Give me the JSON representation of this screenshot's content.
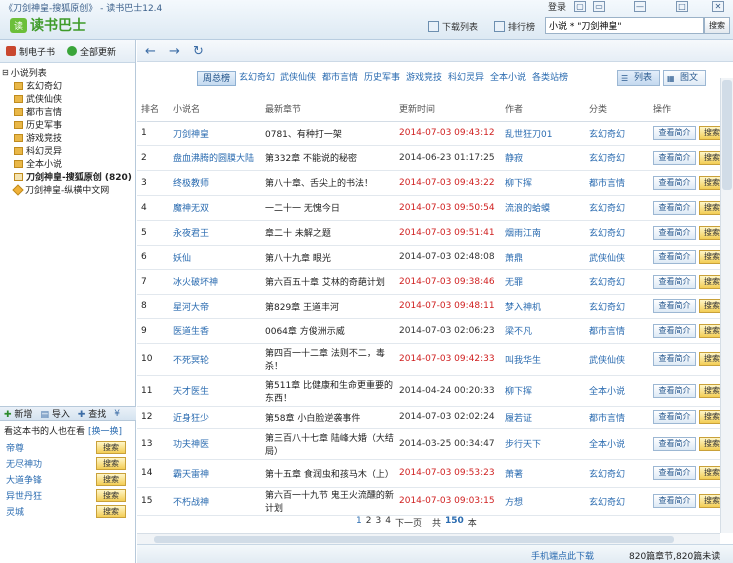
{
  "window": {
    "title": "《刀剑神皇-搜狐原创》 - 读书巴士12.4",
    "app_name": "读书巴士",
    "logo_glyph": "读",
    "login": "登录",
    "controls": [
      "▢",
      "▭",
      "—",
      "□",
      "✕"
    ]
  },
  "toolbar": {
    "downloads": "下载列表",
    "rankings": "排行榜",
    "search_value": "小说 * \"刀剑神皇\"",
    "search_button": "搜索"
  },
  "sidebar": {
    "make_ebook": "制电子书",
    "update_all": "全部更新",
    "tree_root": "小说列表",
    "tree_items": [
      "玄幻奇幻",
      "武侠仙侠",
      "都市言情",
      "历史军事",
      "游戏竞技",
      "科幻灵异",
      "全本小说"
    ],
    "tree_book": "刀剑神皇-搜狐原创 (820)",
    "tree_book2": "刀剑神皇-纵横中文网",
    "tools": {
      "add": "新增",
      "import": "导入",
      "find": "查找"
    },
    "also_reading": "看这本书的人也在看",
    "refresh": "[换一换]",
    "recommendations": [
      "帝尊",
      "无尽神功",
      "大道争锋",
      "异世丹狂",
      "灵城"
    ],
    "search_button": "搜索"
  },
  "navbar": {
    "back": "←",
    "forward": "→",
    "refresh": "↻"
  },
  "categories": [
    "周总榜",
    "玄幻奇幻",
    "武侠仙侠",
    "都市言情",
    "历史军事",
    "游戏竞技",
    "科幻灵异",
    "全本小说",
    "各类站榜"
  ],
  "view": {
    "list": "列表",
    "grid": "图文"
  },
  "table": {
    "headers": [
      "排名",
      "小说名",
      "最新章节",
      "更新时间",
      "作者",
      "分类",
      "操作"
    ],
    "intro_label": "查看简介",
    "search_label": "搜索",
    "rows": [
      {
        "rank": "1",
        "title": "刀剑神皇",
        "chapter": "0781、有种打一架",
        "time": "2014-07-03  09:43:12",
        "red": true,
        "author": "乱世狂刀01",
        "cat": "玄幻奇幻"
      },
      {
        "rank": "2",
        "title": "盘血沸腾的圆膜大陆",
        "chapter": "第332章  不能说的秘密",
        "time": "2014-06-23  01:17:25",
        "red": false,
        "author": "静寂",
        "cat": "玄幻奇幻"
      },
      {
        "rank": "3",
        "title": "终极教师",
        "chapter": "第八十章、舌尖上的书法！",
        "time": "2014-07-03  09:43:22",
        "red": true,
        "author": "柳下挥",
        "cat": "都市言情"
      },
      {
        "rank": "4",
        "title": "魔神无双",
        "chapter": "一二十一  无愧今日",
        "time": "2014-07-03  09:50:54",
        "red": true,
        "author": "流浪的蛤蟆",
        "cat": "玄幻奇幻"
      },
      {
        "rank": "5",
        "title": "永夜君王",
        "chapter": "章二十  未解之题",
        "time": "2014-07-03  09:51:41",
        "red": true,
        "author": "烟雨江南",
        "cat": "玄幻奇幻"
      },
      {
        "rank": "6",
        "title": "妖仙",
        "chapter": "第八十九章  眼光",
        "time": "2014-07-03  02:48:08",
        "red": false,
        "author": "萧鼎",
        "cat": "武侠仙侠"
      },
      {
        "rank": "7",
        "title": "冰火破坏神",
        "chapter": "第六百五十章  艾林的奇葩计划",
        "time": "2014-07-03  09:38:46",
        "red": true,
        "author": "无罪",
        "cat": "玄幻奇幻"
      },
      {
        "rank": "8",
        "title": "星河大帝",
        "chapter": "第829章  王道丰河",
        "time": "2014-07-03  09:48:11",
        "red": true,
        "author": "梦入神机",
        "cat": "玄幻奇幻"
      },
      {
        "rank": "9",
        "title": "医道生香",
        "chapter": "0064章  方俊洲示威",
        "time": "2014-07-03  02:06:23",
        "red": false,
        "author": "梁不凡",
        "cat": "都市言情"
      },
      {
        "rank": "10",
        "title": "不死冥轮",
        "chapter": "第四百一十二章  法则不二，毒杀！",
        "time": "2014-07-03  09:42:33",
        "red": true,
        "author": "叫我华生",
        "cat": "武侠仙侠"
      },
      {
        "rank": "11",
        "title": "天才医生",
        "chapter": "第511章  比健康和生命更重要的东西！",
        "time": "2014-04-24  00:20:33",
        "red": false,
        "author": "柳下挥",
        "cat": "全本小说"
      },
      {
        "rank": "12",
        "title": "近身狂少",
        "chapter": "第58章  小白脸逆袭事件",
        "time": "2014-07-03  02:02:24",
        "red": false,
        "author": "履若证",
        "cat": "都市言情"
      },
      {
        "rank": "13",
        "title": "功夫神医",
        "chapter": "第三百八十七章  陆峰大婚（大结局）",
        "time": "2014-03-25  00:34:47",
        "red": false,
        "author": "步行天下",
        "cat": "全本小说"
      },
      {
        "rank": "14",
        "title": "霸天雷神",
        "chapter": "第十五章  食润虫和孩马木（上）",
        "time": "2014-07-03  09:53:23",
        "red": true,
        "author": "萧著",
        "cat": "玄幻奇幻"
      },
      {
        "rank": "15",
        "title": "不朽战神",
        "chapter": "第六百一十九节  鬼王火流醺的新计划",
        "time": "2014-07-03  09:03:15",
        "red": true,
        "author": "方想",
        "cat": "玄幻奇幻"
      }
    ]
  },
  "pager": {
    "p1": "1",
    "p2": "2",
    "p3": "3",
    "p4": "4",
    "next": "下一页",
    "total_prefix": "共",
    "total": "150",
    "total_suffix": "本"
  },
  "status": {
    "mobile": "手机端点此下载",
    "counts": "820篇章节,820篇未读"
  }
}
